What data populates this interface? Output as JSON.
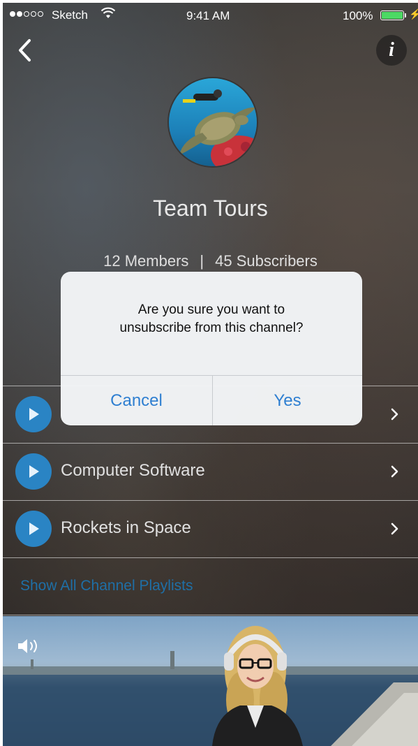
{
  "status_bar": {
    "carrier": "Sketch",
    "time": "9:41 AM",
    "battery": "100%",
    "signal_bars_filled": 2,
    "signal_bars_total": 5
  },
  "nav": {
    "back_icon": "chevron-left-icon",
    "info_label": "i"
  },
  "channel": {
    "title": "Team Tours",
    "members": "12 Members",
    "separator": "|",
    "subscribers": "45 Subscribers"
  },
  "playlists": {
    "items": [
      {
        "label": ""
      },
      {
        "label": "Computer Software"
      },
      {
        "label": "Rockets in Space"
      }
    ],
    "show_all": "Show All Channel Playlists"
  },
  "dialog": {
    "message": "Are you sure you want to\nunsubscribe from this channel?",
    "cancel_label": "Cancel",
    "yes_label": "Yes"
  },
  "colors": {
    "accent": "#2f7fd1",
    "play_button": "#2a84c4",
    "battery": "#4cd964",
    "link": "#1f6fa6"
  }
}
